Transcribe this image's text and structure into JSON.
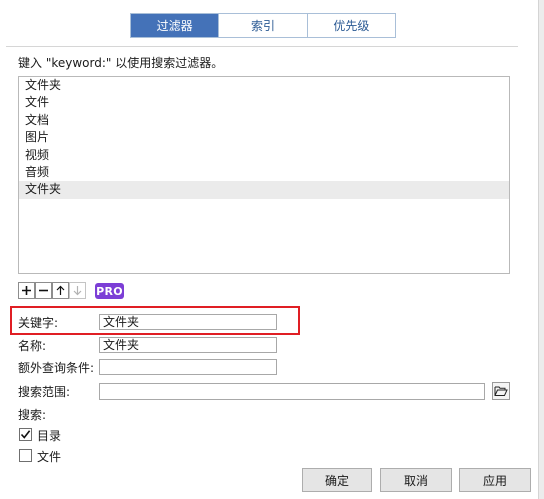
{
  "tabs": [
    {
      "label": "过滤器",
      "active": true
    },
    {
      "label": "索引",
      "active": false
    },
    {
      "label": "优先级",
      "active": false
    }
  ],
  "hint": "键入 \"keyword:\" 以使用搜索过滤器。",
  "filter_list": [
    "文件夹",
    "文件",
    "文档",
    "图片",
    "视频",
    "音频",
    "文件夹"
  ],
  "selected_index": 6,
  "toolbar": {
    "add_icon": "plus-icon",
    "remove_icon": "minus-icon",
    "up_icon": "arrow-up-icon",
    "down_icon": "arrow-down-icon",
    "pro_badge": "PRO"
  },
  "form": {
    "keyword_label": "关键字:",
    "keyword_value": "文件夹",
    "name_label": "名称:",
    "name_value": "文件夹",
    "extra_label": "额外查询条件:",
    "extra_value": "",
    "scope_label": "搜索范围:",
    "scope_value": "",
    "browse_icon": "folder-open-icon",
    "search_label": "搜索:",
    "dir_label": "目录",
    "dir_checked": true,
    "file_label": "文件",
    "file_checked": false
  },
  "buttons": {
    "ok": "确定",
    "cancel": "取消",
    "apply": "应用"
  },
  "colors": {
    "tab_active": "#4472b8",
    "pro_badge": "#7c3ed6",
    "highlight": "#e01e24"
  }
}
